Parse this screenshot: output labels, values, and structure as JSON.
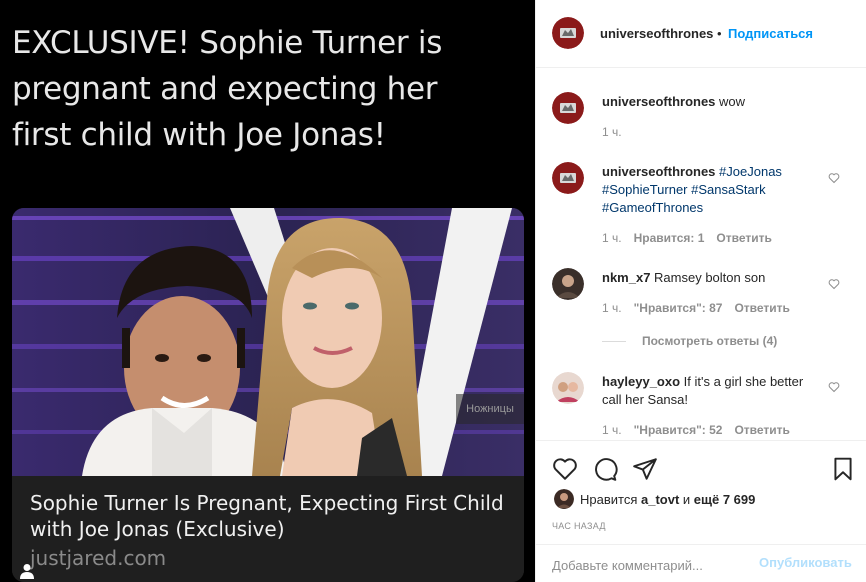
{
  "post": {
    "headline": "EXCLUSIVE! Sophie Turner is pregnant and expecting her first child with Joe Jonas!",
    "card_title": "Sophie Turner Is Pregnant, Expecting First Child with Joe Jonas (Exclusive)",
    "card_source": "justjared.com",
    "watermark": "Ножницы"
  },
  "header": {
    "username": "universeofthrones",
    "separator": "•",
    "follow_label": "Подписаться"
  },
  "comments": [
    {
      "username": "universeofthrones",
      "text": " wow",
      "time": "1 ч."
    },
    {
      "username": "universeofthrones",
      "text": " ",
      "hashtags": [
        "#JoeJonas",
        "#SophieTurner",
        "#SansaStark",
        "#GameofThrones"
      ],
      "time": "1 ч.",
      "likes": "Нравится: 1",
      "reply": "Ответить"
    },
    {
      "username": "nkm_x7",
      "text": " Ramsey bolton son",
      "time": "1 ч.",
      "likes": "\"Нравится\": 87",
      "reply": "Ответить",
      "view_replies": "Посмотреть ответы (4)"
    },
    {
      "username": "hayleyy_oxo",
      "text": " If it's a girl she better call her Sansa!",
      "time": "1 ч.",
      "likes": "\"Нравится\": 52",
      "reply": "Ответить"
    }
  ],
  "actions": {
    "likes_prefix": "Нравится ",
    "likes_user": "a_tovt",
    "likes_middle": " и ",
    "likes_count": "ещё 7 699",
    "time_ago": "час назад"
  },
  "add_comment": {
    "placeholder": "Добавьте комментарий...",
    "publish_label": "Опубликовать"
  },
  "colors": {
    "accent": "#0095f6",
    "hashtag": "#00376b",
    "publish_disabled": "#b2dffc"
  }
}
